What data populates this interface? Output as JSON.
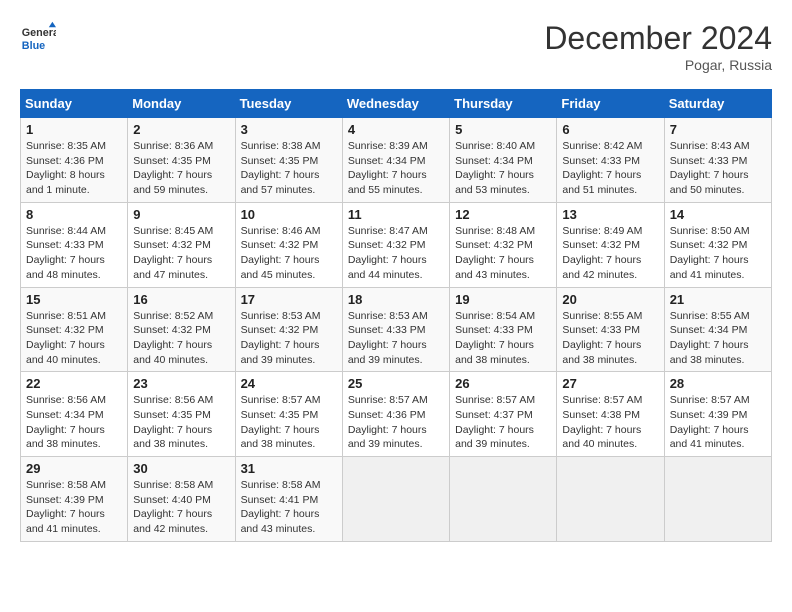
{
  "header": {
    "logo_general": "General",
    "logo_blue": "Blue",
    "title": "December 2024",
    "subtitle": "Pogar, Russia"
  },
  "calendar": {
    "days_of_week": [
      "Sunday",
      "Monday",
      "Tuesday",
      "Wednesday",
      "Thursday",
      "Friday",
      "Saturday"
    ],
    "weeks": [
      [
        {
          "day": "1",
          "sunrise": "Sunrise: 8:35 AM",
          "sunset": "Sunset: 4:36 PM",
          "daylight": "Daylight: 8 hours and 1 minute."
        },
        {
          "day": "2",
          "sunrise": "Sunrise: 8:36 AM",
          "sunset": "Sunset: 4:35 PM",
          "daylight": "Daylight: 7 hours and 59 minutes."
        },
        {
          "day": "3",
          "sunrise": "Sunrise: 8:38 AM",
          "sunset": "Sunset: 4:35 PM",
          "daylight": "Daylight: 7 hours and 57 minutes."
        },
        {
          "day": "4",
          "sunrise": "Sunrise: 8:39 AM",
          "sunset": "Sunset: 4:34 PM",
          "daylight": "Daylight: 7 hours and 55 minutes."
        },
        {
          "day": "5",
          "sunrise": "Sunrise: 8:40 AM",
          "sunset": "Sunset: 4:34 PM",
          "daylight": "Daylight: 7 hours and 53 minutes."
        },
        {
          "day": "6",
          "sunrise": "Sunrise: 8:42 AM",
          "sunset": "Sunset: 4:33 PM",
          "daylight": "Daylight: 7 hours and 51 minutes."
        },
        {
          "day": "7",
          "sunrise": "Sunrise: 8:43 AM",
          "sunset": "Sunset: 4:33 PM",
          "daylight": "Daylight: 7 hours and 50 minutes."
        }
      ],
      [
        {
          "day": "8",
          "sunrise": "Sunrise: 8:44 AM",
          "sunset": "Sunset: 4:33 PM",
          "daylight": "Daylight: 7 hours and 48 minutes."
        },
        {
          "day": "9",
          "sunrise": "Sunrise: 8:45 AM",
          "sunset": "Sunset: 4:32 PM",
          "daylight": "Daylight: 7 hours and 47 minutes."
        },
        {
          "day": "10",
          "sunrise": "Sunrise: 8:46 AM",
          "sunset": "Sunset: 4:32 PM",
          "daylight": "Daylight: 7 hours and 45 minutes."
        },
        {
          "day": "11",
          "sunrise": "Sunrise: 8:47 AM",
          "sunset": "Sunset: 4:32 PM",
          "daylight": "Daylight: 7 hours and 44 minutes."
        },
        {
          "day": "12",
          "sunrise": "Sunrise: 8:48 AM",
          "sunset": "Sunset: 4:32 PM",
          "daylight": "Daylight: 7 hours and 43 minutes."
        },
        {
          "day": "13",
          "sunrise": "Sunrise: 8:49 AM",
          "sunset": "Sunset: 4:32 PM",
          "daylight": "Daylight: 7 hours and 42 minutes."
        },
        {
          "day": "14",
          "sunrise": "Sunrise: 8:50 AM",
          "sunset": "Sunset: 4:32 PM",
          "daylight": "Daylight: 7 hours and 41 minutes."
        }
      ],
      [
        {
          "day": "15",
          "sunrise": "Sunrise: 8:51 AM",
          "sunset": "Sunset: 4:32 PM",
          "daylight": "Daylight: 7 hours and 40 minutes."
        },
        {
          "day": "16",
          "sunrise": "Sunrise: 8:52 AM",
          "sunset": "Sunset: 4:32 PM",
          "daylight": "Daylight: 7 hours and 40 minutes."
        },
        {
          "day": "17",
          "sunrise": "Sunrise: 8:53 AM",
          "sunset": "Sunset: 4:32 PM",
          "daylight": "Daylight: 7 hours and 39 minutes."
        },
        {
          "day": "18",
          "sunrise": "Sunrise: 8:53 AM",
          "sunset": "Sunset: 4:33 PM",
          "daylight": "Daylight: 7 hours and 39 minutes."
        },
        {
          "day": "19",
          "sunrise": "Sunrise: 8:54 AM",
          "sunset": "Sunset: 4:33 PM",
          "daylight": "Daylight: 7 hours and 38 minutes."
        },
        {
          "day": "20",
          "sunrise": "Sunrise: 8:55 AM",
          "sunset": "Sunset: 4:33 PM",
          "daylight": "Daylight: 7 hours and 38 minutes."
        },
        {
          "day": "21",
          "sunrise": "Sunrise: 8:55 AM",
          "sunset": "Sunset: 4:34 PM",
          "daylight": "Daylight: 7 hours and 38 minutes."
        }
      ],
      [
        {
          "day": "22",
          "sunrise": "Sunrise: 8:56 AM",
          "sunset": "Sunset: 4:34 PM",
          "daylight": "Daylight: 7 hours and 38 minutes."
        },
        {
          "day": "23",
          "sunrise": "Sunrise: 8:56 AM",
          "sunset": "Sunset: 4:35 PM",
          "daylight": "Daylight: 7 hours and 38 minutes."
        },
        {
          "day": "24",
          "sunrise": "Sunrise: 8:57 AM",
          "sunset": "Sunset: 4:35 PM",
          "daylight": "Daylight: 7 hours and 38 minutes."
        },
        {
          "day": "25",
          "sunrise": "Sunrise: 8:57 AM",
          "sunset": "Sunset: 4:36 PM",
          "daylight": "Daylight: 7 hours and 39 minutes."
        },
        {
          "day": "26",
          "sunrise": "Sunrise: 8:57 AM",
          "sunset": "Sunset: 4:37 PM",
          "daylight": "Daylight: 7 hours and 39 minutes."
        },
        {
          "day": "27",
          "sunrise": "Sunrise: 8:57 AM",
          "sunset": "Sunset: 4:38 PM",
          "daylight": "Daylight: 7 hours and 40 minutes."
        },
        {
          "day": "28",
          "sunrise": "Sunrise: 8:57 AM",
          "sunset": "Sunset: 4:39 PM",
          "daylight": "Daylight: 7 hours and 41 minutes."
        }
      ],
      [
        {
          "day": "29",
          "sunrise": "Sunrise: 8:58 AM",
          "sunset": "Sunset: 4:39 PM",
          "daylight": "Daylight: 7 hours and 41 minutes."
        },
        {
          "day": "30",
          "sunrise": "Sunrise: 8:58 AM",
          "sunset": "Sunset: 4:40 PM",
          "daylight": "Daylight: 7 hours and 42 minutes."
        },
        {
          "day": "31",
          "sunrise": "Sunrise: 8:58 AM",
          "sunset": "Sunset: 4:41 PM",
          "daylight": "Daylight: 7 hours and 43 minutes."
        },
        null,
        null,
        null,
        null
      ]
    ]
  }
}
